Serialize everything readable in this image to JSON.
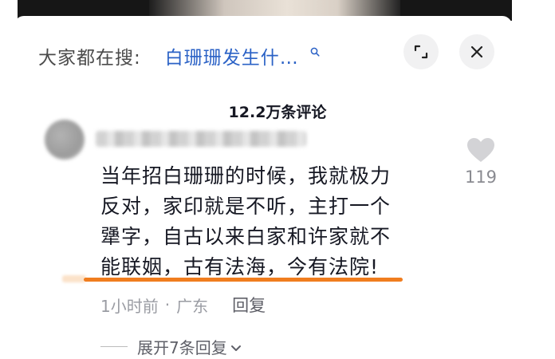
{
  "search_bar": {
    "label": "大家都在搜:",
    "term": "白珊珊发生什…"
  },
  "comments_header": {
    "count": "12.2万条评论"
  },
  "comment": {
    "lines": [
      "当年招白珊珊的时候，我就极力",
      "反对，家印就是不听，主打一个",
      "犟字，自古以来白家和许家就不",
      "能联姻，古有法海，今有法院!"
    ],
    "time": "1小时前",
    "separator": "·",
    "location": "广东",
    "reply_label": "回复",
    "likes": "119",
    "expand_label": "展开7条回复"
  },
  "icons": {
    "search": "search-icon",
    "expand": "expand-icon",
    "close": "close-icon",
    "like": "heart-icon",
    "chevron": "chevron-down-icon"
  },
  "colors": {
    "link_blue": "#2b62c6",
    "underline_orange": "#f07d1f",
    "muted_gray": "#9a9ca3",
    "heart_gray": "#d3d3d6"
  }
}
